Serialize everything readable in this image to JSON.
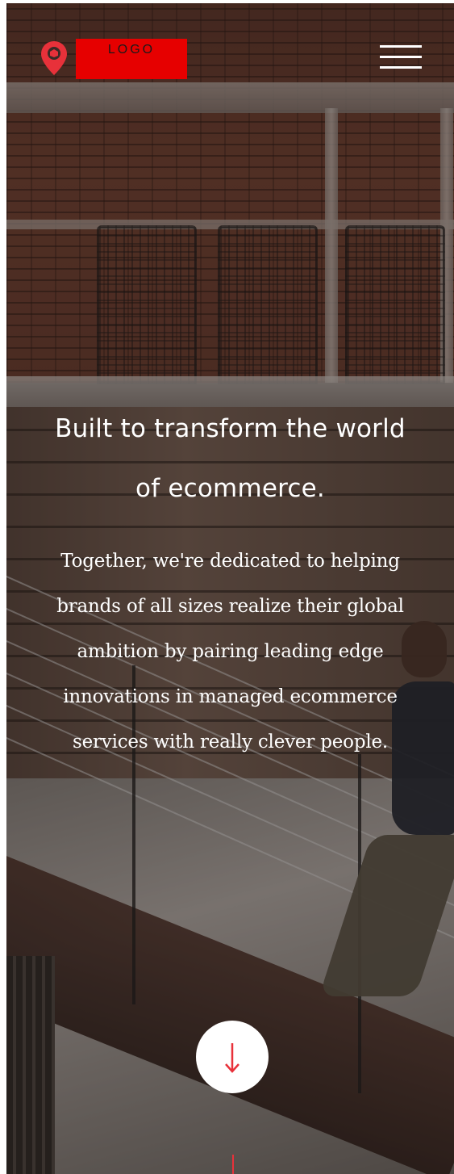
{
  "header": {
    "logo_text": "LOGO",
    "logo_icon": "map-pin-icon",
    "menu_icon": "hamburger-menu-icon"
  },
  "hero": {
    "title_line1": "Built to transform the world",
    "title_line2": "of ecommerce.",
    "text_lines": [
      "Together, we're dedicated to helping",
      "brands of all sizes realize their global",
      "ambition by pairing leading edge",
      "innovations in managed ecommerce",
      "services with really clever people."
    ]
  },
  "scroll": {
    "icon": "arrow-down-icon"
  },
  "colors": {
    "accent": "#e8313a",
    "logo_bg": "#e60000",
    "text": "#ffffff"
  }
}
